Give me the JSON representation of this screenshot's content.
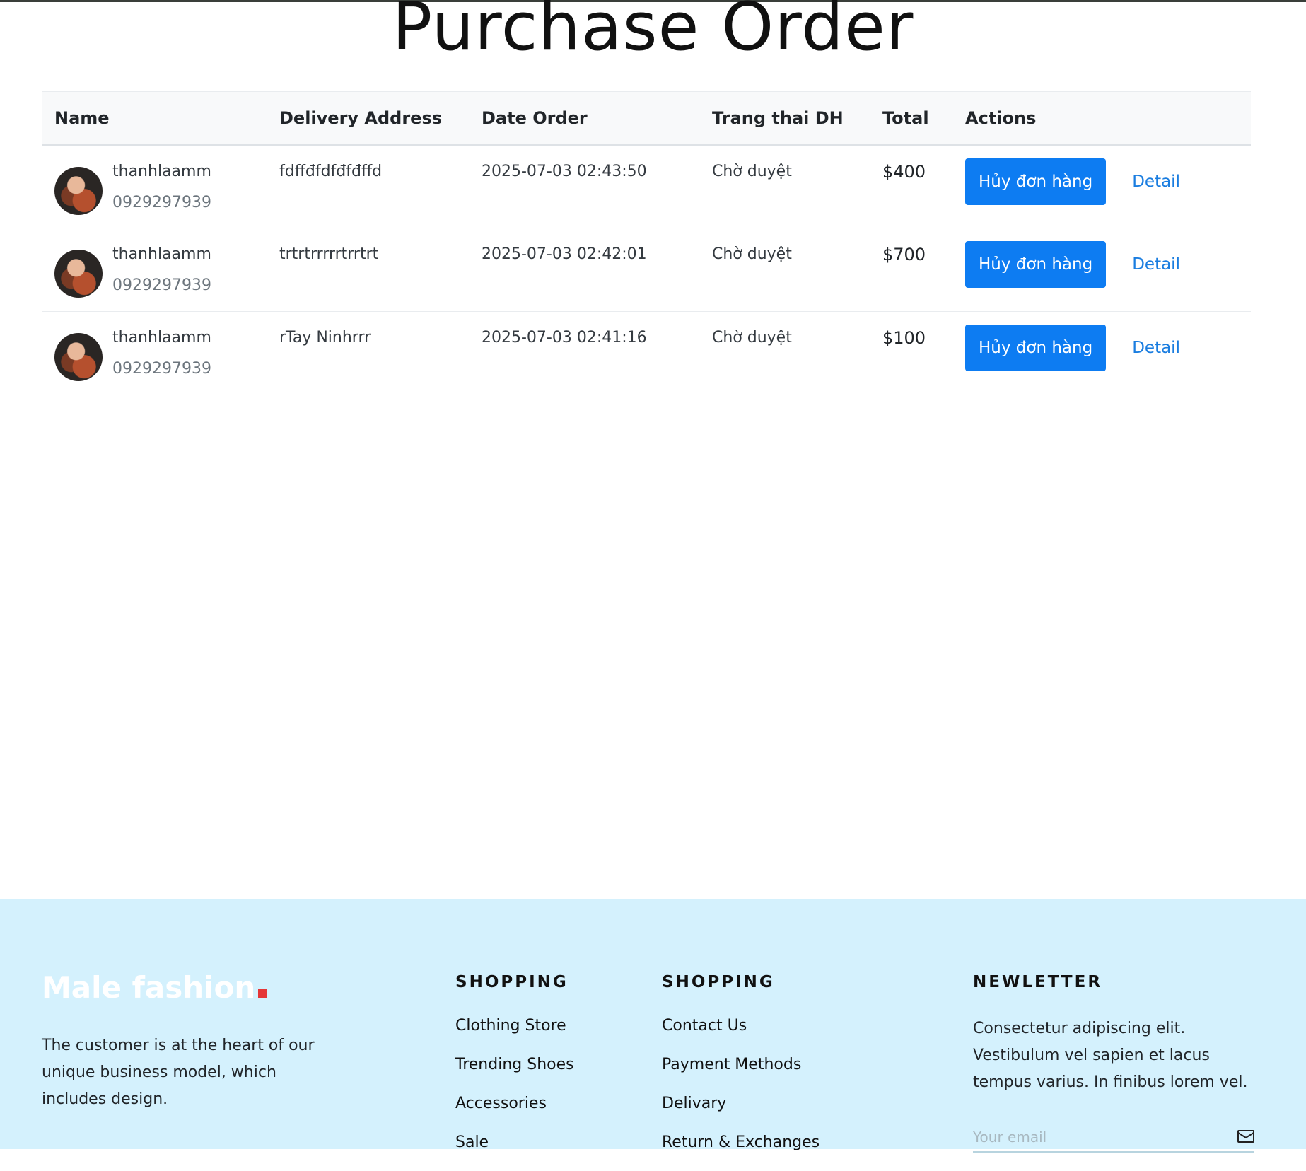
{
  "page": {
    "title": "Purchase Order"
  },
  "table": {
    "headers": {
      "name": "Name",
      "delivery_address": "Delivery Address",
      "date_order": "Date Order",
      "status": "Trang thai DH",
      "total": "Total",
      "actions": "Actions"
    },
    "rows": [
      {
        "customer_name": "thanhlaamm",
        "phone": "0929297939",
        "address": "fdffđfdfđfđffd",
        "date": "2025-07-03 02:43:50",
        "status": "Chờ duyệt",
        "total": "$400",
        "cancel_label": "Hủy đơn hàng",
        "detail_label": "Detail"
      },
      {
        "customer_name": "thanhlaamm",
        "phone": "0929297939",
        "address": "trtrtrrrrrtrrtrt",
        "date": "2025-07-03 02:42:01",
        "status": "Chờ duyệt",
        "total": "$700",
        "cancel_label": "Hủy đơn hàng",
        "detail_label": "Detail"
      },
      {
        "customer_name": "thanhlaamm",
        "phone": "0929297939",
        "address": "rTay Ninhrrr",
        "date": "2025-07-03 02:41:16",
        "status": "Chờ duyệt",
        "total": "$100",
        "cancel_label": "Hủy đơn hàng",
        "detail_label": "Detail"
      }
    ]
  },
  "footer": {
    "logo_text": "Male fashion",
    "description": "The customer is at the heart of our unique business model, which includes design.",
    "shopping1": {
      "heading": "SHOPPING",
      "links": [
        "Clothing Store",
        "Trending Shoes",
        "Accessories",
        "Sale"
      ]
    },
    "shopping2": {
      "heading": "SHOPPING",
      "links": [
        "Contact Us",
        "Payment Methods",
        "Delivary",
        "Return & Exchanges"
      ]
    },
    "newsletter": {
      "heading": "NEWLETTER",
      "text": "Consectetur adipiscing elit. Vestibulum vel sapien et lacus tempus varius. In finibus lorem vel.",
      "email_placeholder": "Your email",
      "submit_icon": "envelope-icon"
    }
  },
  "colors": {
    "primary_button": "#0d7cf2",
    "link": "#1a7de0",
    "footer_bg": "#d4f1fd",
    "logo_dot": "#e53637"
  }
}
